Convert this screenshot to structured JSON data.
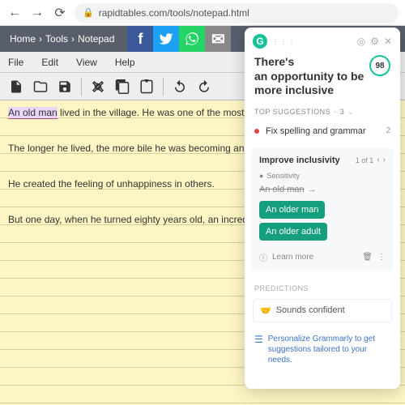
{
  "browser": {
    "url": "rapidtables.com/tools/notepad.html"
  },
  "breadcrumb": [
    "Home",
    "Tools",
    "Notepad"
  ],
  "menu": {
    "file": "File",
    "edit": "Edit",
    "view": "View",
    "help": "Help"
  },
  "note": {
    "l1a": "An old man",
    "l1b": " lived in the village. He was one of the most unfortu",
    "l2": "The longer he lived, the more bile he was becoming and the m",
    "l3": "He created the feeling of unhappiness in others.",
    "l4": "But one day, when he turned eighty years old, an incredible thi"
  },
  "grammarly": {
    "title": "There's\nan opportunity to be more inclusive",
    "score": "98",
    "top_label": "TOP SUGGESTIONS",
    "top_count": "3",
    "sugg1": {
      "label": "Fix spelling and grammar",
      "count": "2"
    },
    "card": {
      "title": "Improve inclusivity",
      "count": "1 of 1",
      "sensitivity": "Sensitivity",
      "original": "An old man",
      "option1": "An older man",
      "option2": "An older adult",
      "learn": "Learn more"
    },
    "predictions_label": "PREDICTIONS",
    "prediction1": "Sounds confident",
    "personalize": "Personalize Grammarly to get suggestions tailored to your needs."
  }
}
